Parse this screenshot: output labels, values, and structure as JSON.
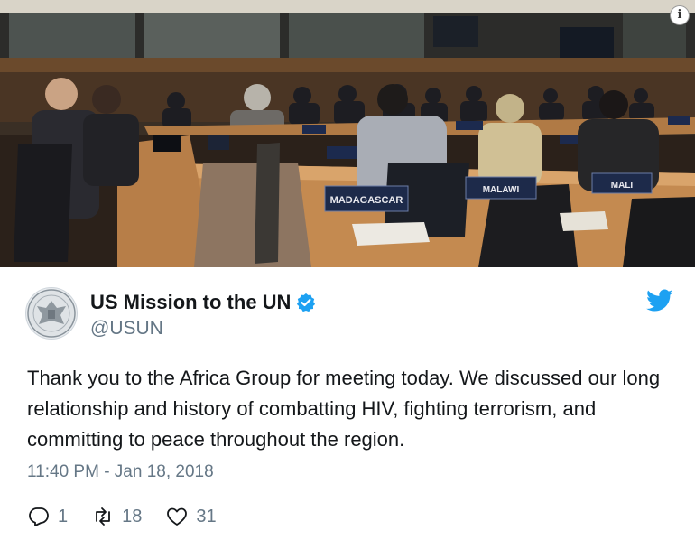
{
  "photo": {
    "placards": [
      "MADAGASCAR",
      "MALAWI",
      "MALI"
    ]
  },
  "tweet": {
    "display_name": "US Mission to the UN",
    "handle": "@USUN",
    "text": "Thank you to the Africa Group for meeting today. We discussed our long relationship and history of combatting HIV, fighting terrorism, and committing to peace throughout the region.",
    "timestamp": "11:40 PM - Jan 18, 2018",
    "replies": "1",
    "retweets": "18",
    "likes": "31"
  },
  "colors": {
    "verified": "#1da1f2",
    "twitter_bird": "#1da1f2",
    "muted": "#657786"
  },
  "icons": [
    "info-icon",
    "verified-badge-icon",
    "twitter-bird-icon",
    "reply-icon",
    "retweet-icon",
    "like-icon"
  ]
}
